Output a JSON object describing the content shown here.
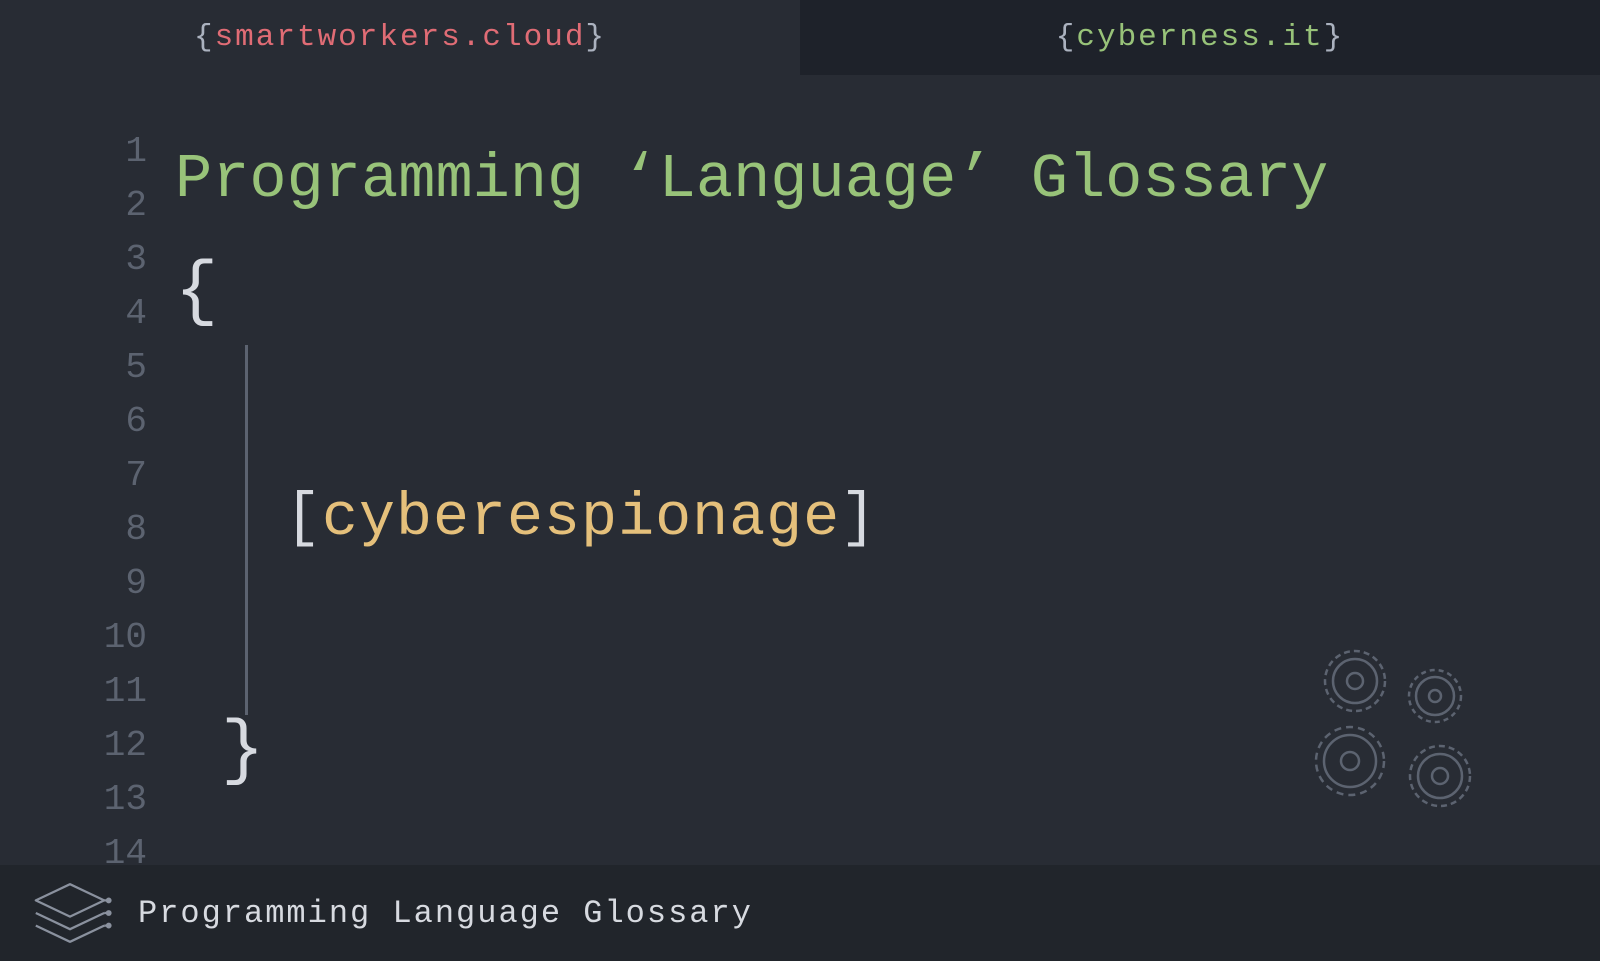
{
  "tabs": {
    "active": {
      "brace_open": "{",
      "domain": "smartworkers.cloud",
      "brace_close": "}"
    },
    "inactive": {
      "brace_open": "{",
      "domain": "cyberness.it",
      "brace_close": "}"
    }
  },
  "gutter": {
    "lines": [
      "1",
      "2",
      "3",
      "4",
      "5",
      "6",
      "7",
      "8",
      "9",
      "10",
      "11",
      "12",
      "13",
      "14"
    ]
  },
  "content": {
    "title": "Programming ‘Language’ Glossary",
    "open_brace": "{",
    "close_brace": "}",
    "bracket_open": "[",
    "term": "cyberespionage",
    "bracket_close": "]"
  },
  "footer": {
    "title": "Programming Language Glossary"
  }
}
